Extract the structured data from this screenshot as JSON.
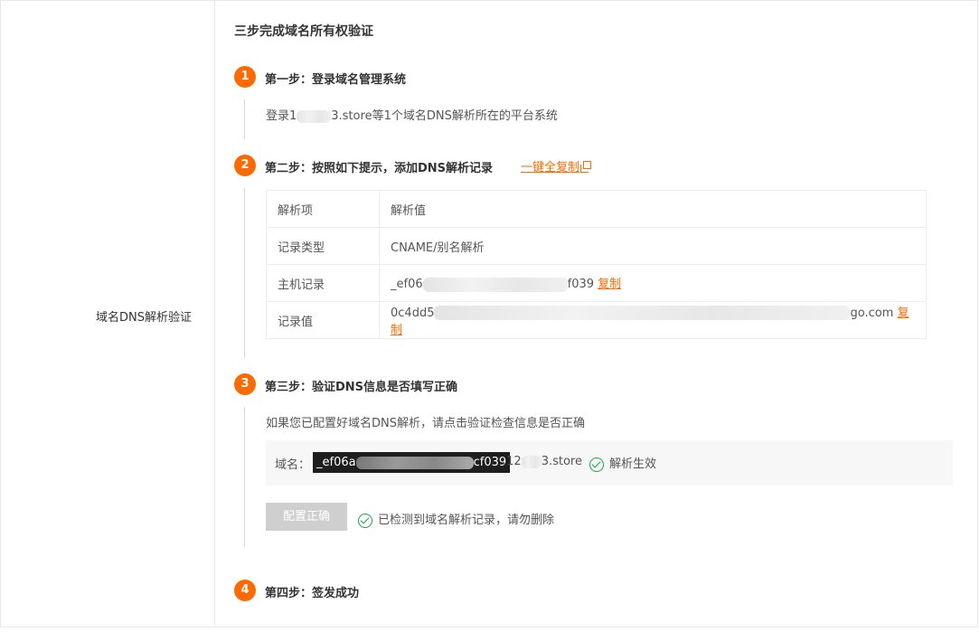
{
  "row_label": "域名DNS解析验证",
  "heading": "三步完成域名所有权验证",
  "steps": [
    {
      "num": "1",
      "title": "第一步：登录域名管理系统",
      "text_pre": "登录1",
      "text_post": "3.store等1个域名DNS解析所在的平台系统"
    },
    {
      "num": "2",
      "title": "第二步：按照如下提示，添加DNS解析记录",
      "copy_all": "一键全复制"
    },
    {
      "num": "3",
      "title": "第三步：验证DNS信息是否填写正确",
      "text": "如果您已配置好域名DNS解析，请点击验证检查信息是否正确"
    },
    {
      "num": "4",
      "title": "第四步：签发成功"
    }
  ],
  "table": {
    "header": {
      "key": "解析项",
      "value": "解析值"
    },
    "rows": [
      {
        "key": "记录类型",
        "value_pre": "CNAME/别名解析",
        "value_post": "",
        "copy": ""
      },
      {
        "key": "主机记录",
        "value_pre": "_ef06",
        "value_post": "f039",
        "copy": "复制"
      },
      {
        "key": "记录值",
        "value_pre": "0c4dd5",
        "value_post": "go.com",
        "copy": "复制"
      }
    ]
  },
  "domain": {
    "label": "域名：",
    "value_pre": "_ef06a",
    "value_post": "cf039",
    "tail_pre": ".12",
    "tail_post": "3.store",
    "status": "解析生效"
  },
  "verify_button": "配置正确",
  "detected_text": "已检测到域名解析记录，请勿删除",
  "colors": {
    "accent": "#ff6a00",
    "success": "#1aa34a"
  }
}
